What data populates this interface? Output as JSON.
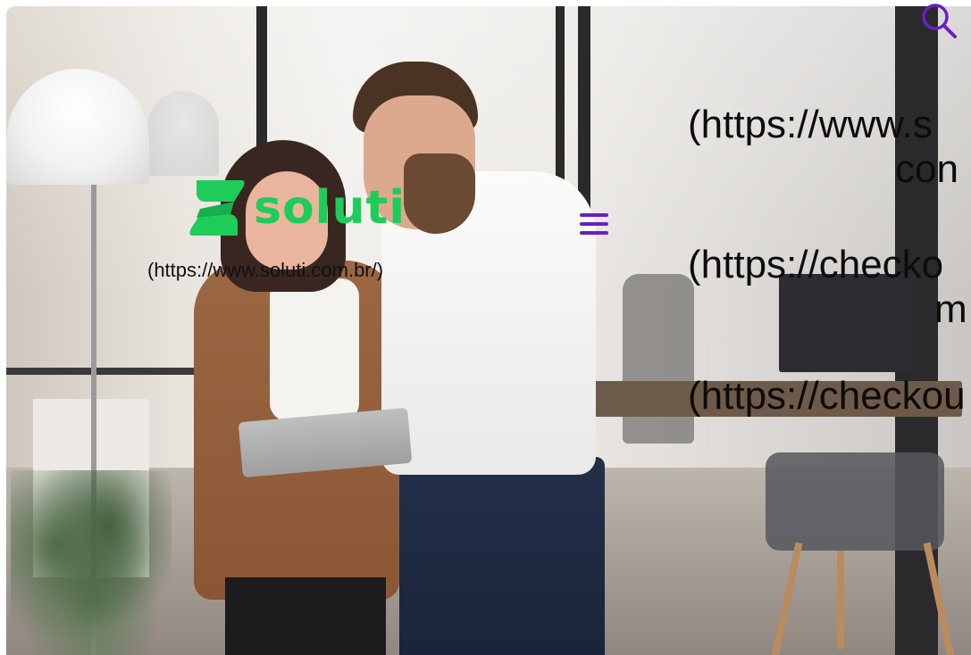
{
  "header": {
    "logo": {
      "wordmark": "soluti",
      "brand_color": "#1ecc5a",
      "link_text": "(https://www.soluti.com.br/)"
    },
    "menu_icon": {
      "name": "hamburger-menu-icon",
      "color": "#6a1fc2"
    },
    "search_icon": {
      "name": "search-icon",
      "color": "#6a1fc2"
    }
  },
  "nav": {
    "items": [
      {
        "line1": "(https://www.s",
        "line2": "con"
      },
      {
        "line1": "(https://checko",
        "line2": "m"
      },
      {
        "line1": "(https://checkou",
        "line2": ""
      }
    ]
  }
}
